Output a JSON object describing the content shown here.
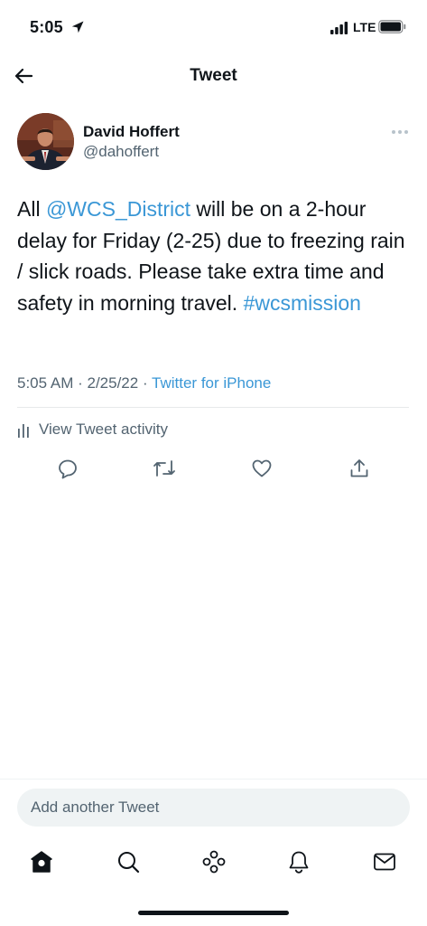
{
  "status_bar": {
    "time": "5:05",
    "network": "LTE"
  },
  "header": {
    "title": "Tweet"
  },
  "tweet": {
    "author_name": "David Hoffert",
    "author_handle": "@dahoffert",
    "text_parts": {
      "p1": "All ",
      "mention": "@WCS_District",
      "p2": " will be on a 2-hour delay for Friday (2-25) due to freezing rain / slick roads. Please take extra time and safety in morning travel. ",
      "hashtag": "#wcsmission"
    },
    "time": "5:05 AM",
    "date": "2/25/22",
    "separator": " · ",
    "source": "Twitter for iPhone",
    "activity_label": "View Tweet activity"
  },
  "actions": {
    "reply": "reply-icon",
    "retweet": "retweet-icon",
    "like": "heart-icon",
    "share": "share-icon"
  },
  "composer": {
    "placeholder": "Add another Tweet"
  },
  "tab_bar": {
    "items": [
      "home-icon",
      "search-icon",
      "spaces-icon",
      "notifications-icon",
      "messages-icon"
    ]
  },
  "colors": {
    "link": "#3a97d6",
    "text": "#0f1419",
    "secondary": "#536471",
    "divider": "#e7e9ea"
  }
}
